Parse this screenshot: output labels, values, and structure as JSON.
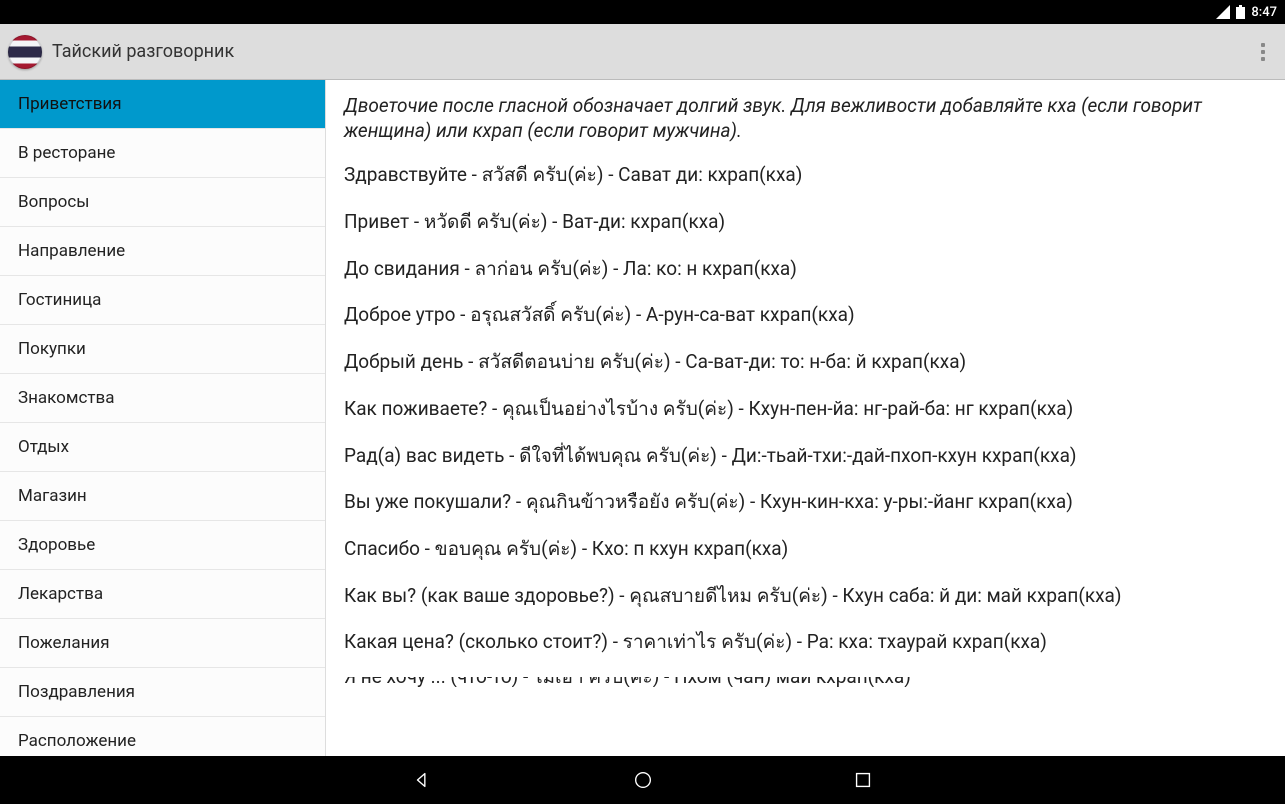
{
  "statusbar": {
    "time": "8:47"
  },
  "actionbar": {
    "title": "Тайский разговорник"
  },
  "sidebar": {
    "active_index": 0,
    "items": [
      "Приветствия",
      "В ресторане",
      "Вопросы",
      "Направление",
      "Гостиница",
      "Покупки",
      "Знакомства",
      "Отдых",
      "Магазин",
      "Здоровье",
      "Лекарства",
      "Пожелания",
      "Поздравления",
      "Расположение"
    ]
  },
  "content": {
    "intro": "Двоеточие после гласной обозначает долгий звук. Для вежливости добавляйте кха (если говорит женщина) или кхрап (если говорит мужчина).",
    "phrases": [
      "Здравствуйте - สวัสดี ครับ(ค่ะ) - Сават ди: кхрап(кха)",
      "Привет - หวัดดี ครับ(ค่ะ) - Ват-ди: кхрап(кха)",
      "До свидания - ลาก่อน ครับ(ค่ะ) - Ла: ко: н кхрап(кха)",
      "Доброе утро - อรุณสวัสดิ์ ครับ(ค่ะ) - А-рун-са-ват кхрап(кха)",
      "Добрый день - สวัสดีตอนบ่าย ครับ(ค่ะ) - Са-ват-ди: то: н-ба: й кхрап(кха)",
      "Как поживаете? - คุณเป็นอย่างไรบ้าง ครับ(ค่ะ) - Кхун-пен-йа: нг-рай-ба: нг кхрап(кха)",
      "Рад(а) вас видеть - ดีใจที่ได้พบคุณ ครับ(ค่ะ) - Ди:-тьай-тхи:-дай-пхоп-кхун кхрап(кха)",
      "Вы уже покушали? - คุณกินข้าวหรือยัง ครับ(ค่ะ) - Кхун-кин-кха: у-ры:-йанг кхрап(кха)",
      "Спасибо - ขอบคุณ ครับ(ค่ะ) - Кхо: п кхун кхрап(кха)",
      "Как вы? (как ваше здоровье?) - คุณสบายดีไหม ครับ(ค่ะ) - Кхун саба: й ди: май кхрап(кха)",
      "Какая цена? (сколько стоит?) - ราคาเท่าไร ครับ(ค่ะ) - Ра: кха: тхаурай кхрап(кха)"
    ],
    "partial_phrase": "Я не хочу ... (что-то) - ไม่เอา ครับ(ค่ะ) - Пхом (чан) май кхрап(кха)"
  }
}
